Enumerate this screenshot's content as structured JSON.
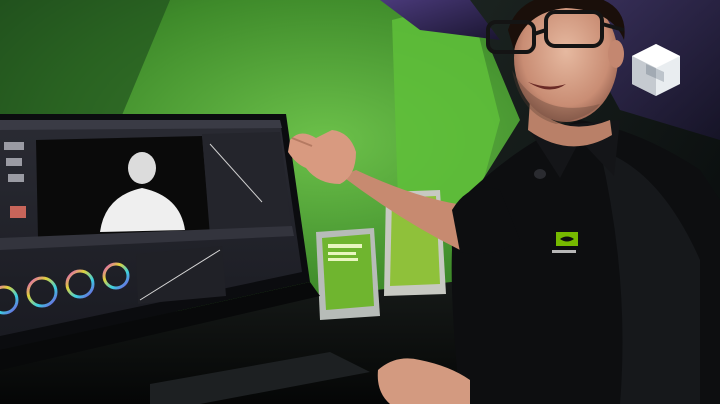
{
  "scene": {
    "description_colors": {
      "green_wall": "#3f8f2a",
      "dark_wall": "#101a14",
      "purple_accent": "#3b2a63",
      "shirt_black": "#0d0d0f",
      "nvidia_green": "#76b900"
    }
  },
  "logo": {
    "icon": "cube-logo-icon"
  },
  "monitor": {
    "app_icon": "video-editor-app",
    "wheel_count": 4
  },
  "display_plaques": {
    "front_icon": "award-plaque-icon",
    "back_icon": "award-plaque-icon"
  },
  "shirt_logo": {
    "icon": "nvidia-logo-icon"
  }
}
